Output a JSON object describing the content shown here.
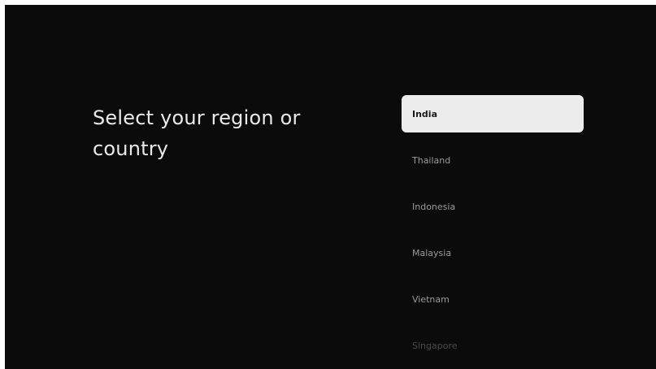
{
  "screen": {
    "title": "Select your region or country"
  },
  "regions": {
    "items": [
      {
        "label": "India",
        "selected": true
      },
      {
        "label": "Thailand"
      },
      {
        "label": "Indonesia"
      },
      {
        "label": "Malaysia"
      },
      {
        "label": "Vietnam"
      },
      {
        "label": "Singapore"
      }
    ]
  },
  "colors": {
    "background": "#0b0b0b",
    "selected_bg": "#ececec",
    "text": "#e9e9e9"
  }
}
